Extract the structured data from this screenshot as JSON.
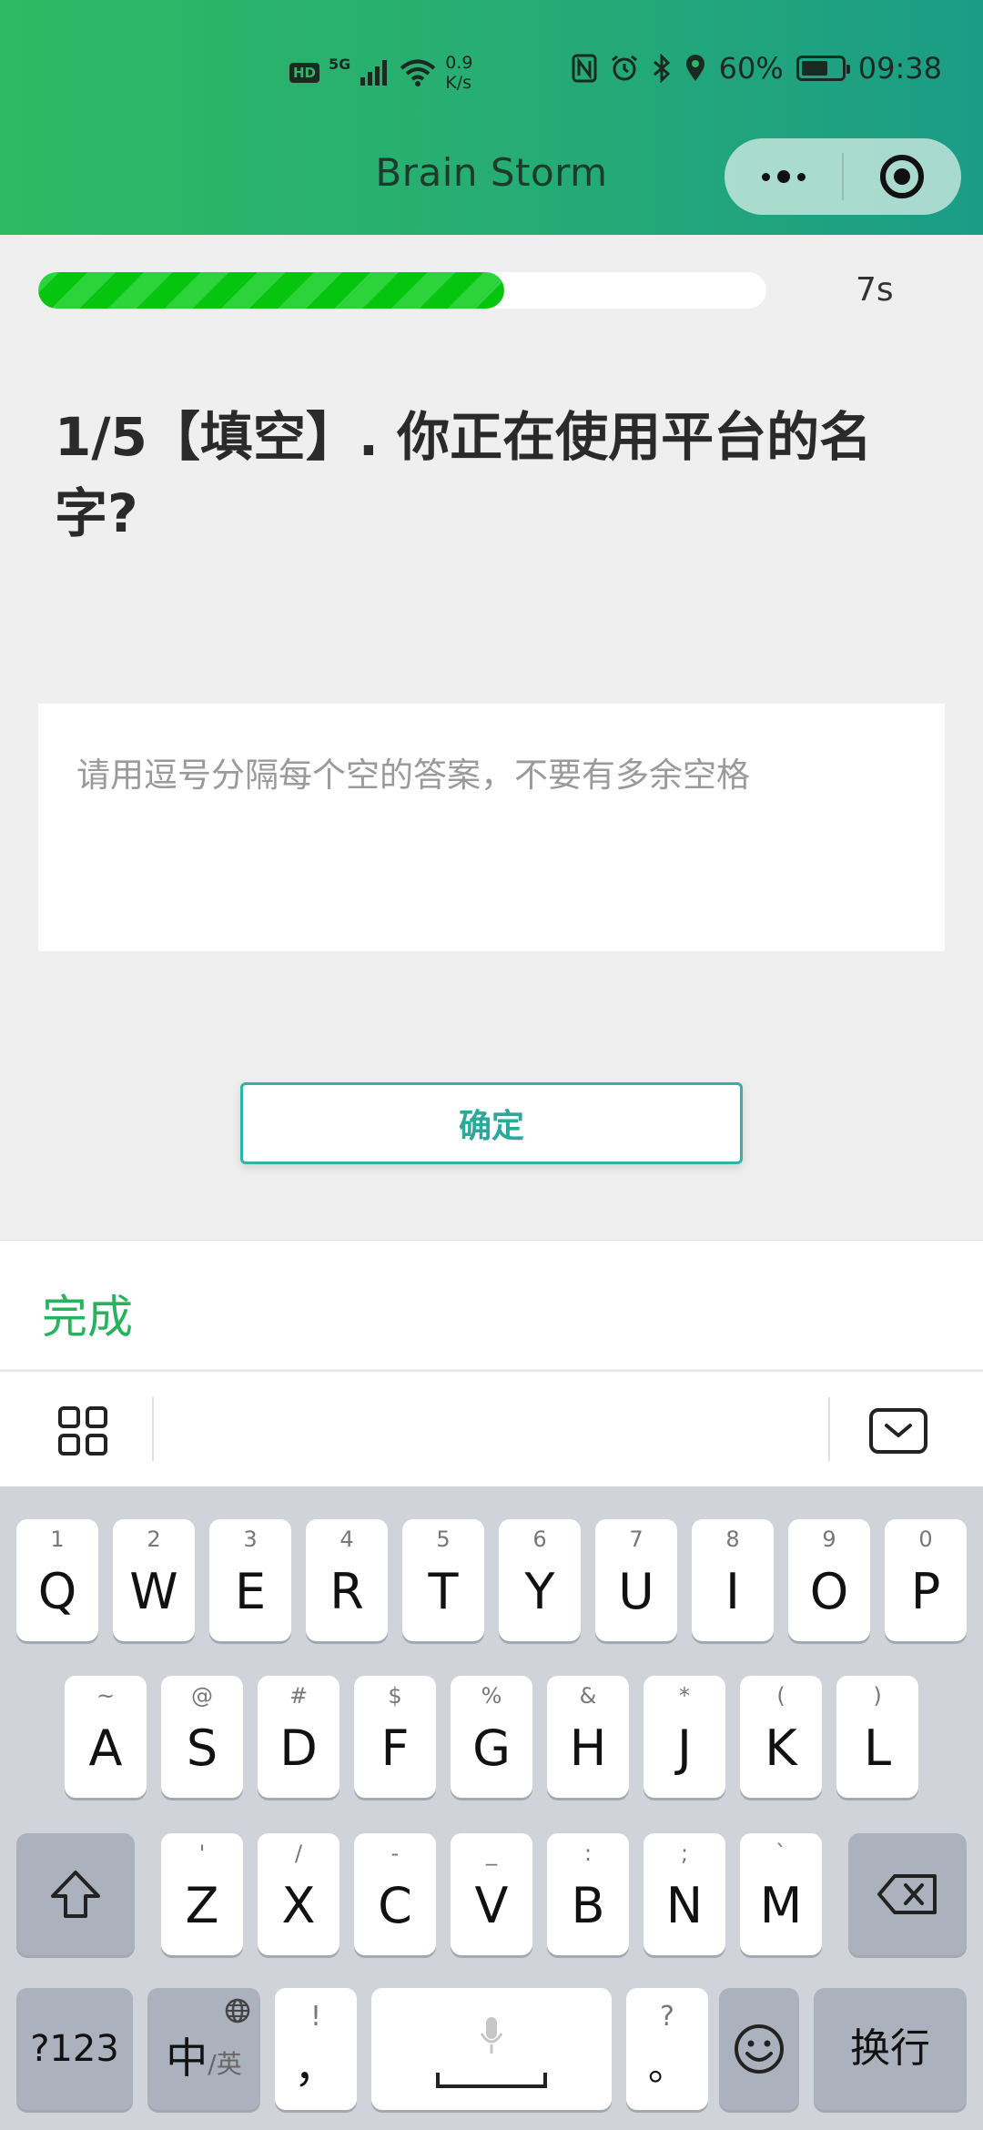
{
  "status_bar": {
    "hd": "HD",
    "signal_type": "5G",
    "net_speed_value": "0.9",
    "net_speed_unit": "K/s",
    "battery_percent": "60%",
    "time": "09:38"
  },
  "header": {
    "title": "Brain Storm",
    "icons": {
      "more": "more-dots-icon",
      "close": "target-circle-icon"
    }
  },
  "quiz": {
    "progress": 0.64,
    "timer": "7s",
    "question": "1/5【填空】. 你正在使用平台的名字?",
    "answer_placeholder": "请用逗号分隔每个空的答案，不要有多余空格",
    "answer_value": "",
    "confirm_label": "确定"
  },
  "keyboard_bar": {
    "done_label": "完成"
  },
  "keyboard": {
    "row1": [
      {
        "main": "Q",
        "sub": "1"
      },
      {
        "main": "W",
        "sub": "2"
      },
      {
        "main": "E",
        "sub": "3"
      },
      {
        "main": "R",
        "sub": "4"
      },
      {
        "main": "T",
        "sub": "5"
      },
      {
        "main": "Y",
        "sub": "6"
      },
      {
        "main": "U",
        "sub": "7"
      },
      {
        "main": "I",
        "sub": "8"
      },
      {
        "main": "O",
        "sub": "9"
      },
      {
        "main": "P",
        "sub": "0"
      }
    ],
    "row2": [
      {
        "main": "A",
        "sub": "~"
      },
      {
        "main": "S",
        "sub": "@"
      },
      {
        "main": "D",
        "sub": "#"
      },
      {
        "main": "F",
        "sub": "$"
      },
      {
        "main": "G",
        "sub": "%"
      },
      {
        "main": "H",
        "sub": "&"
      },
      {
        "main": "J",
        "sub": "*"
      },
      {
        "main": "K",
        "sub": "("
      },
      {
        "main": "L",
        "sub": ")"
      }
    ],
    "row3": [
      {
        "main": "Z",
        "sub": "'"
      },
      {
        "main": "X",
        "sub": "/"
      },
      {
        "main": "C",
        "sub": "-"
      },
      {
        "main": "V",
        "sub": "_"
      },
      {
        "main": "B",
        "sub": ":"
      },
      {
        "main": "N",
        "sub": ";"
      },
      {
        "main": "M",
        "sub": "`"
      }
    ],
    "numbers_label": "?123",
    "lang_main": "中",
    "lang_sub": "/英",
    "comma_main": "，",
    "comma_sub": "!",
    "period_main": "。",
    "period_sub": "?",
    "enter_label": "换行",
    "icons": {
      "shift": "shift-arrow-icon",
      "backspace": "backspace-icon",
      "globe": "globe-icon",
      "mic": "microphone-icon",
      "emoji": "emoji-smiley-icon",
      "grid": "grid-apps-icon",
      "hide": "hide-keyboard-icon"
    }
  }
}
